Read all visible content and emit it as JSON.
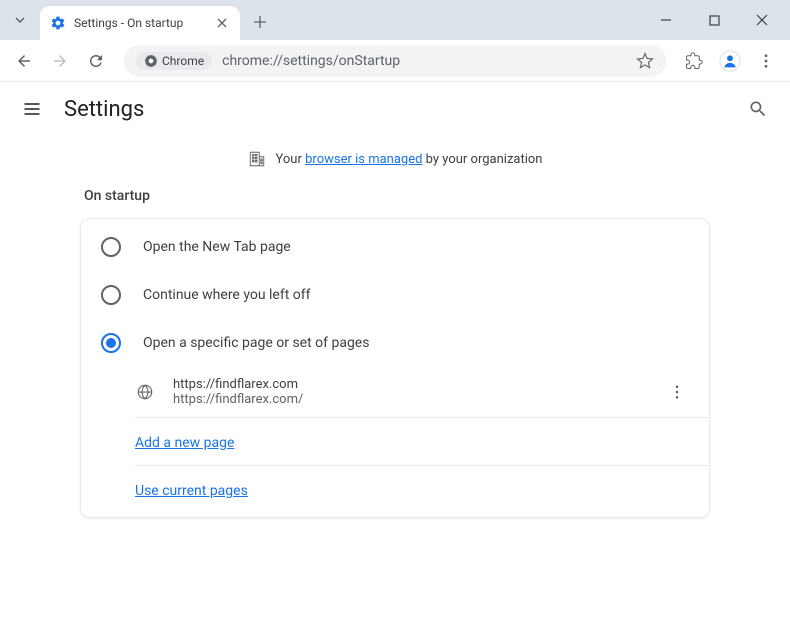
{
  "window": {
    "tab_title": "Settings - On startup"
  },
  "toolbar": {
    "chrome_chip": "Chrome",
    "url": "chrome://settings/onStartup"
  },
  "header": {
    "title": "Settings"
  },
  "managed": {
    "prefix": "Your ",
    "link": "browser is managed",
    "suffix": " by your organization"
  },
  "section": {
    "title": "On startup",
    "options": [
      {
        "label": "Open the New Tab page",
        "selected": false
      },
      {
        "label": "Continue where you left off",
        "selected": false
      },
      {
        "label": "Open a specific page or set of pages",
        "selected": true
      }
    ],
    "page_entry": {
      "title": "https://findflarex.com",
      "url": "https://findflarex.com/"
    },
    "add_page_label": "Add a new page",
    "use_current_label": "Use current pages"
  }
}
